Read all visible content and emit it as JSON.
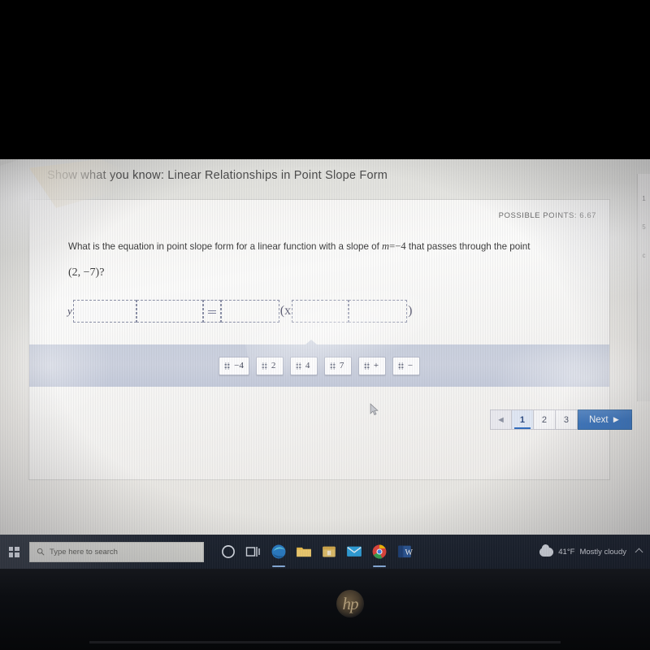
{
  "app": {
    "title": "Show what you know: Linear Relationships in Point Slope Form",
    "possible_points": "POSSIBLE POINTS: 6.67"
  },
  "question": {
    "text_before_var": "What is the equation in point slope form for a linear function with a slope of ",
    "slope_var": "m",
    "slope_eq": "=",
    "slope_value": "−4",
    "text_after": " that passes through the point",
    "point": "(2, −7)?"
  },
  "answer_expression": {
    "lead_var": "y",
    "equals_symbol": "=",
    "open_paren_x": "(x",
    "close_paren": ")",
    "slots": [
      {
        "id": "slot-1",
        "value": ""
      },
      {
        "id": "slot-2",
        "value": ""
      },
      {
        "id": "slot-3",
        "value": ""
      },
      {
        "id": "slot-4",
        "value": ""
      },
      {
        "id": "slot-5",
        "value": ""
      }
    ]
  },
  "tiles": [
    {
      "label": "−4",
      "name": "tile-negative-4"
    },
    {
      "label": "2",
      "name": "tile-2"
    },
    {
      "label": "4",
      "name": "tile-4"
    },
    {
      "label": "7",
      "name": "tile-7"
    },
    {
      "label": "+",
      "name": "tile-plus"
    },
    {
      "label": "−",
      "name": "tile-minus"
    }
  ],
  "pagination": {
    "prev_label": "◄",
    "pages": [
      "1",
      "2",
      "3"
    ],
    "active_page": "1",
    "next_label": "Next",
    "next_arrow": "►"
  },
  "side_rail": {
    "marks": [
      "1",
      "5",
      "c"
    ]
  },
  "taskbar": {
    "search_placeholder": "Type here to search",
    "weather_temp": "41°F",
    "weather_desc": "Mostly cloudy",
    "icons": [
      "cortana-icon",
      "task-view-icon",
      "edge-icon",
      "file-explorer-icon",
      "store-icon",
      "mail-icon",
      "chrome-icon",
      "word-icon"
    ]
  },
  "device": {
    "brand": "hp"
  },
  "colors": {
    "accent_blue": "#3f77bd",
    "active_page": "#2c4b82",
    "tray_band": "#c9cfdd",
    "dashed_border": "#8a8fa6"
  }
}
